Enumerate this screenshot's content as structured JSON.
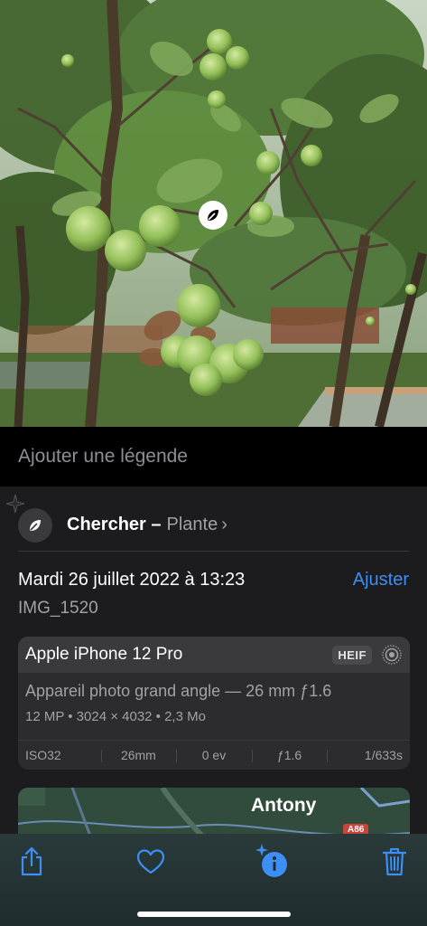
{
  "caption": {
    "placeholder": "Ajouter une légende"
  },
  "visual_lookup": {
    "title": "Chercher –",
    "subject": "Plante",
    "chevron": "›",
    "icon": "leaf-icon"
  },
  "details": {
    "date": "Mardi 26 juillet 2022 à 13:23",
    "adjust_label": "Ajuster",
    "filename": "IMG_1520"
  },
  "camera": {
    "device": "Apple iPhone 12 Pro",
    "format": "HEIF",
    "lens": "Appareil photo grand angle — 26 mm ƒ1.6",
    "specs": "12 MP • 3024 × 4032 • 2,3 Mo",
    "exif": [
      "ISO32",
      "26mm",
      "0 ev",
      "ƒ1.6",
      "1/633s"
    ]
  },
  "map": {
    "place": "Antony",
    "road": "A86"
  },
  "toolbar": {
    "icons": [
      "share-icon",
      "heart-icon",
      "info-sparkle-icon",
      "trash-icon"
    ],
    "accent": "#3d8ff5"
  }
}
